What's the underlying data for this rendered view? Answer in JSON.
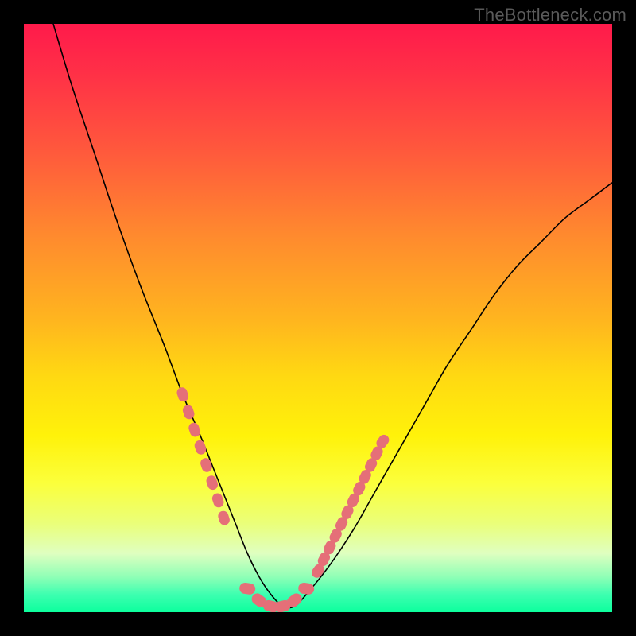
{
  "watermark": "TheBottleneck.com",
  "colors": {
    "frame": "#000000",
    "marker": "#e56f78",
    "curve": "#000000",
    "gradient_stops": [
      "#ff1a4b",
      "#ff5a3c",
      "#ffb41f",
      "#fff20a",
      "#eaff7a",
      "#0cff9d"
    ]
  },
  "chart_data": {
    "type": "line",
    "title": "",
    "xlabel": "",
    "ylabel": "",
    "xlim": [
      0,
      100
    ],
    "ylim": [
      0,
      100
    ],
    "grid": false,
    "legend_position": "none",
    "series": [
      {
        "name": "bottleneck-curve",
        "x": [
          5,
          8,
          12,
          16,
          20,
          24,
          27,
          30,
          32,
          34,
          36,
          38,
          40,
          42,
          44,
          46,
          48,
          52,
          56,
          60,
          64,
          68,
          72,
          76,
          80,
          84,
          88,
          92,
          96,
          100
        ],
        "y": [
          100,
          90,
          78,
          66,
          55,
          45,
          37,
          30,
          25,
          20,
          15,
          10,
          6,
          3,
          1,
          1,
          3,
          8,
          14,
          21,
          28,
          35,
          42,
          48,
          54,
          59,
          63,
          67,
          70,
          73
        ]
      }
    ],
    "annotations": [],
    "markers": {
      "name": "highlighted-segments",
      "left_cluster_x": [
        27,
        28,
        29,
        30,
        31,
        32,
        33,
        34
      ],
      "left_cluster_y": [
        37,
        34,
        31,
        28,
        25,
        22,
        19,
        16
      ],
      "bottom_cluster_x": [
        38,
        40,
        42,
        44,
        46,
        48
      ],
      "bottom_cluster_y": [
        4,
        2,
        1,
        1,
        2,
        4
      ],
      "right_cluster_x": [
        50,
        51,
        52,
        53,
        54,
        55,
        56,
        57,
        58,
        59,
        60,
        61
      ],
      "right_cluster_y": [
        7,
        9,
        11,
        13,
        15,
        17,
        19,
        21,
        23,
        25,
        27,
        29
      ]
    }
  }
}
